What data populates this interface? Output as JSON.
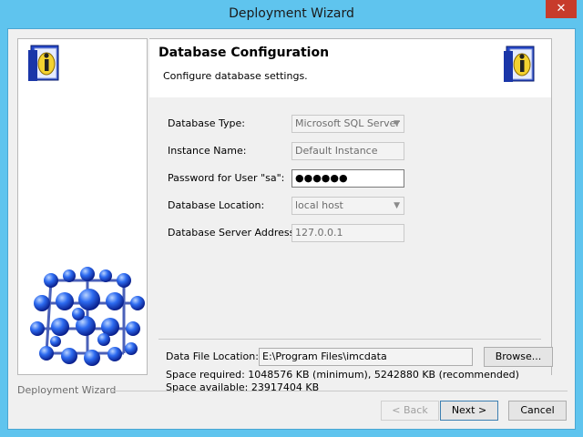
{
  "window": {
    "title": "Deployment Wizard",
    "close_glyph": "✕"
  },
  "header": {
    "title": "Database Configuration",
    "subtitle": "Configure database settings."
  },
  "form": {
    "db_type": {
      "label": "Database Type:",
      "value": "Microsoft SQL Server"
    },
    "instance_name": {
      "label": "Instance Name:",
      "value": "Default Instance"
    },
    "password": {
      "label": "Password for User \"sa\":",
      "value": "●●●●●●"
    },
    "db_location": {
      "label": "Database Location:",
      "value": "local host"
    },
    "db_server_address": {
      "label": "Database Server Address:",
      "value": "127.0.0.1"
    }
  },
  "data_file": {
    "label": "Data File Location:",
    "value": "E:\\Program Files\\imcdata",
    "browse_label": "Browse...",
    "space_required": "Space required: 1048576 KB (minimum), 5242880 KB (recommended)",
    "space_available": "Space available: 23917404 KB"
  },
  "footer": {
    "label": "Deployment Wizard",
    "back_label": "< Back",
    "next_label": "Next >",
    "cancel_label": "Cancel"
  },
  "icons": {
    "info": "info-book-icon",
    "molecule": "molecule-sphere-icon",
    "dropdown": "chevron-down-icon"
  },
  "colors": {
    "title_bar": "#5fc4ee",
    "close": "#c73b2b",
    "sphere": "#1e4fd8"
  }
}
